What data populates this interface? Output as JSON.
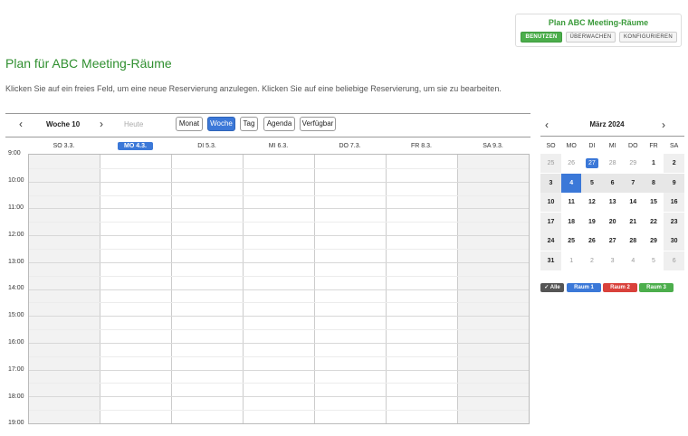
{
  "header": {
    "plan_title": "Plan ABC Meeting-Räume",
    "buttons": [
      "BENUTZEN",
      "ÜBERWACHEN",
      "KONFIGURIEREN"
    ]
  },
  "page": {
    "title": "Plan für ABC Meeting-Räume",
    "description": "Klicken Sie auf ein freies Feld, um eine neue Reservierung anzulegen. Klicken Sie auf eine beliebige Reservierung, um sie zu bearbeiten."
  },
  "toolbar": {
    "prev": "‹",
    "next": "›",
    "week_label": "Woche 10",
    "today": "Heute",
    "views": [
      "Monat",
      "Woche",
      "Tag",
      "Agenda",
      "Verfügbar"
    ],
    "active_view": "Woche"
  },
  "days": [
    "SO 3.3.",
    "MO 4.3.",
    "DI 5.3.",
    "MI 6.3.",
    "DO 7.3.",
    "FR 8.3.",
    "SA 9.3."
  ],
  "times": [
    "9:00",
    "10:00",
    "11:00",
    "12:00",
    "13:00",
    "14:00",
    "15:00",
    "16:00",
    "17:00",
    "18:00",
    "19:00"
  ],
  "mini_calendar": {
    "prev": "‹",
    "next": "›",
    "title": "März 2024",
    "weekdays": [
      "SO",
      "MO",
      "DI",
      "MI",
      "DO",
      "FR",
      "SA"
    ],
    "weeks": [
      [
        "25",
        "26",
        "27",
        "28",
        "29",
        "1",
        "2"
      ],
      [
        "3",
        "4",
        "5",
        "6",
        "7",
        "8",
        "9"
      ],
      [
        "10",
        "11",
        "12",
        "13",
        "14",
        "15",
        "16"
      ],
      [
        "17",
        "18",
        "19",
        "20",
        "21",
        "22",
        "23"
      ],
      [
        "24",
        "25",
        "26",
        "27",
        "28",
        "29",
        "30"
      ],
      [
        "31",
        "1",
        "2",
        "3",
        "4",
        "5",
        "6"
      ]
    ]
  },
  "legend": [
    {
      "label": "Alle",
      "color": "#555555"
    },
    {
      "label": "Raum 1",
      "color": "#3b78d8"
    },
    {
      "label": "Raum 2",
      "color": "#d9413b"
    },
    {
      "label": "Raum 3",
      "color": "#4cae4c"
    }
  ]
}
